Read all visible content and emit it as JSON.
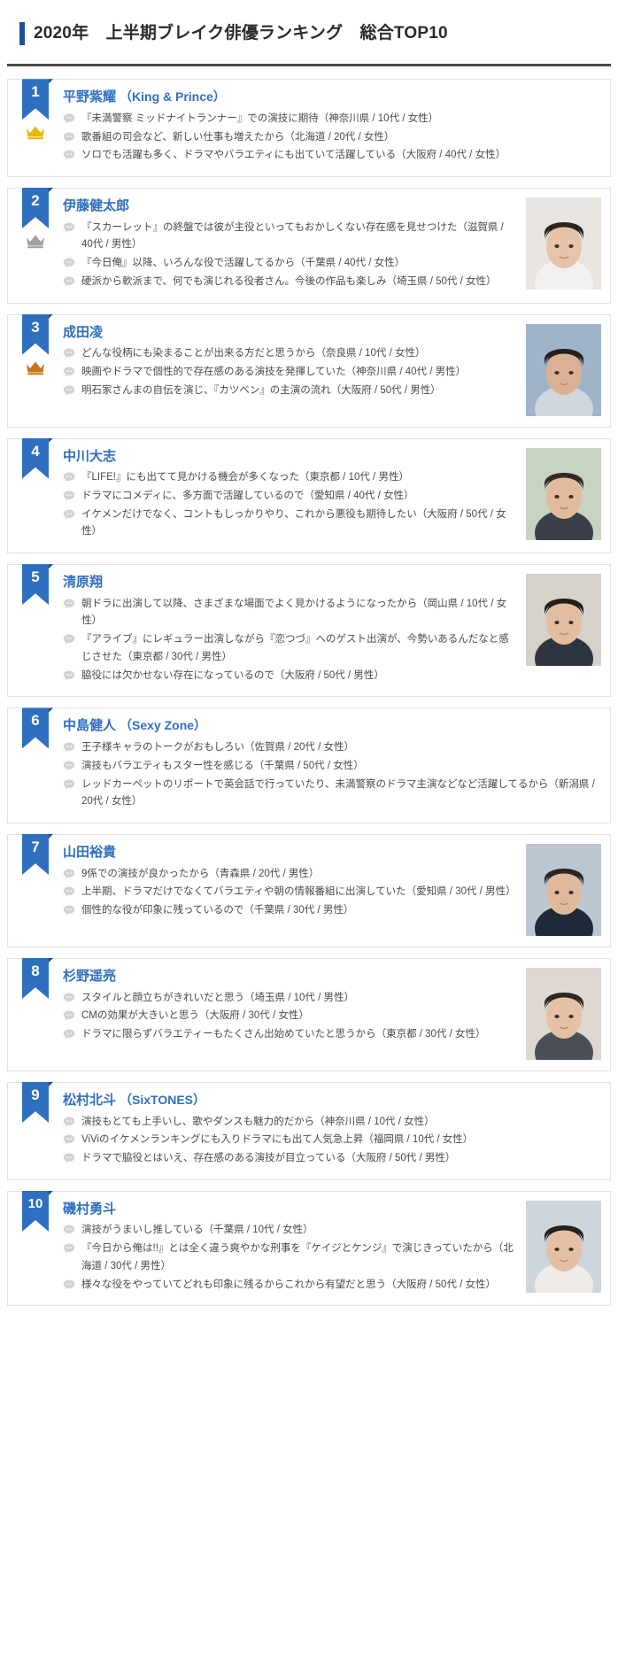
{
  "header": {
    "title": "2020年　上半期ブレイク俳優ランキング　総合TOP10",
    "accent_color": "#1b4f9c"
  },
  "icons": {
    "comment_bubble": "comment-bubble-icon",
    "crown": "crown-icon"
  },
  "medal_colors": {
    "gold": "#e8b80b",
    "silver": "#9ea0a3",
    "bronze": "#c8761e"
  },
  "ranking": [
    {
      "rank": "1",
      "name": "平野紫耀",
      "group": "（King & Prince）",
      "medal": "gold",
      "has_photo": false,
      "comments": [
        "『未満警察 ミッドナイトランナー』での演技に期待（神奈川県 / 10代 / 女性）",
        "歌番組の司会など、新しい仕事も増えたから（北海道 / 20代 / 女性）",
        "ソロでも活躍も多く、ドラマやバラエティにも出ていて活躍している（大阪府 / 40代 / 女性）"
      ]
    },
    {
      "rank": "2",
      "name": "伊藤健太郎",
      "group": "",
      "medal": "silver",
      "has_photo": true,
      "comments": [
        "『スカーレット』の終盤では彼が主役といってもおかしくない存在感を見せつけた（滋賀県 / 40代 / 男性）",
        "『今日俺』以降、いろんな役で活躍してるから（千葉県 / 40代 / 女性）",
        "硬派から軟派まで、何でも演じれる役者さん。今後の作品も楽しみ（埼玉県 / 50代 / 女性）"
      ]
    },
    {
      "rank": "3",
      "name": "成田凌",
      "group": "",
      "medal": "bronze",
      "has_photo": true,
      "comments": [
        "どんな役柄にも染まることが出来る方だと思うから（奈良県 / 10代 / 女性）",
        "映画やドラマで個性的で存在感のある演技を発揮していた（神奈川県 / 40代 / 男性）",
        "明石家さんまの自伝を演じ、『カツベン』の主演の流れ（大阪府 / 50代 / 男性）"
      ]
    },
    {
      "rank": "4",
      "name": "中川大志",
      "group": "",
      "medal": "",
      "has_photo": true,
      "comments": [
        "『LIFE!』にも出てて見かける機会が多くなった（東京都 / 10代 / 男性）",
        "ドラマにコメディに、多方面で活躍しているので（愛知県 / 40代 / 女性）",
        "イケメンだけでなく、コントもしっかりやり、これから悪役も期待したい（大阪府 / 50代 / 女性）"
      ]
    },
    {
      "rank": "5",
      "name": "清原翔",
      "group": "",
      "medal": "",
      "has_photo": true,
      "comments": [
        "朝ドラに出演して以降、さまざまな場面でよく見かけるようになったから（岡山県 / 10代 / 女性）",
        "『アライブ』にレギュラー出演しながら『恋つづ』へのゲスト出演が、今勢いあるんだなと感じさせた（東京都 / 30代 / 男性）",
        "脇役には欠かせない存在になっているので（大阪府 / 50代 / 男性）"
      ]
    },
    {
      "rank": "6",
      "name": "中島健人",
      "group": "（Sexy Zone）",
      "medal": "",
      "has_photo": false,
      "comments": [
        "王子様キャラのトークがおもしろい（佐賀県 / 20代 / 女性）",
        "演技もバラエティもスター性を感じる（千葉県 / 50代 / 女性）",
        "レッドカーペットのリポートで英会話で行っていたり、未満警察のドラマ主演などなど活躍してるから（新潟県 / 20代 / 女性）"
      ]
    },
    {
      "rank": "7",
      "name": "山田裕貴",
      "group": "",
      "medal": "",
      "has_photo": true,
      "comments": [
        "9係での演技が良かったから（青森県 / 20代 / 男性）",
        "上半期、ドラマだけでなくてバラエティや朝の情報番組に出演していた（愛知県 / 30代 / 男性）",
        "個性的な役が印象に残っているので（千葉県 / 30代 / 男性）"
      ]
    },
    {
      "rank": "8",
      "name": "杉野遥亮",
      "group": "",
      "medal": "",
      "has_photo": true,
      "comments": [
        "スタイルと顔立ちがきれいだと思う（埼玉県 / 10代 / 男性）",
        "CMの効果が大きいと思う（大阪府 / 30代 / 女性）",
        "ドラマに限らずバラエティーもたくさん出始めていたと思うから（東京都 / 30代 / 女性）"
      ]
    },
    {
      "rank": "9",
      "name": "松村北斗",
      "group": "（SixTONES）",
      "medal": "",
      "has_photo": false,
      "comments": [
        "演技もとても上手いし、歌やダンスも魅力的だから（神奈川県 / 10代 / 女性）",
        "ViViのイケメンランキングにも入りドラマにも出て人気急上昇（福岡県 / 10代 / 女性）",
        "ドラマで脇役とはいえ、存在感のある演技が目立っている（大阪府 / 50代 / 男性）"
      ]
    },
    {
      "rank": "10",
      "name": "磯村勇斗",
      "group": "",
      "medal": "",
      "has_photo": true,
      "comments": [
        "演技がうまいし推している（千葉県 / 10代 / 女性）",
        "『今日から俺は!!』とは全く違う爽やかな刑事を『ケイジとケンジ』で演じきっていたから（北海道 / 30代 / 男性）",
        "様々な役をやっていてどれも印象に残るからこれから有望だと思う（大阪府 / 50代 / 女性）"
      ]
    }
  ]
}
